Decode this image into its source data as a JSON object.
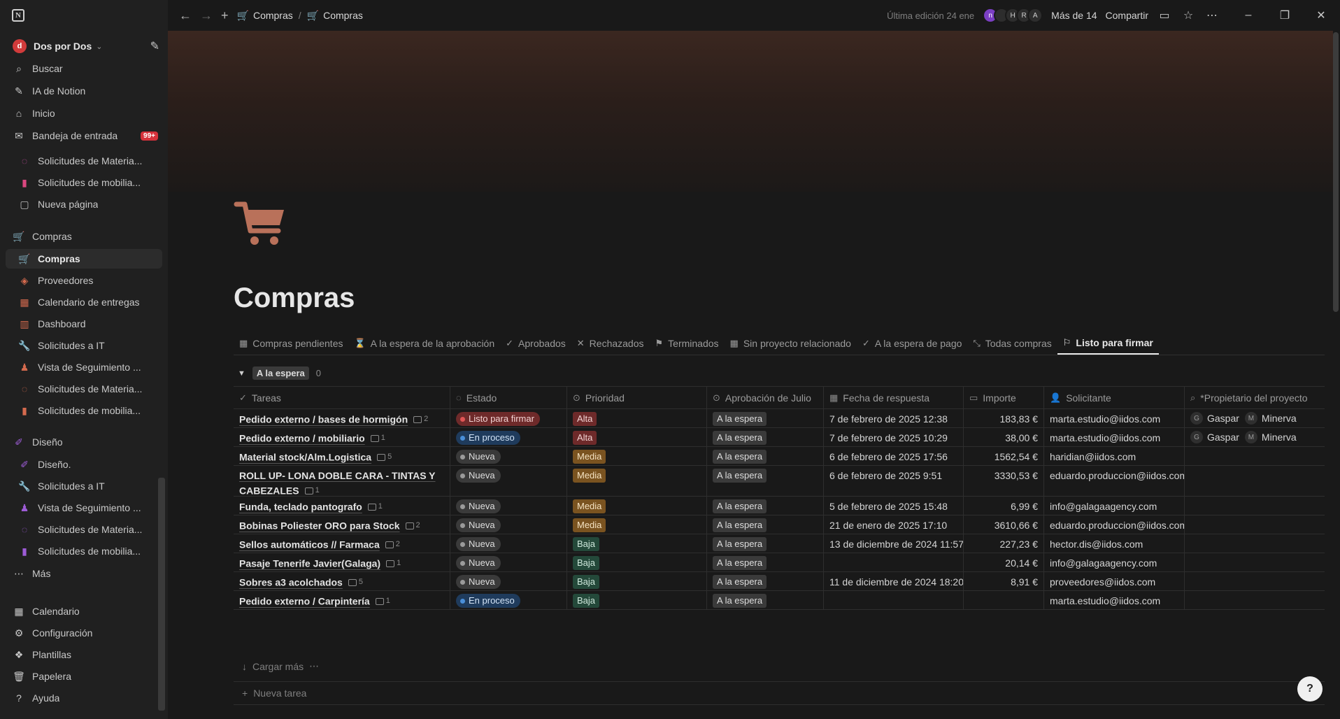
{
  "sidebar": {
    "workspace": {
      "initial": "d",
      "name": "Dos por Dos"
    },
    "top_items": [
      {
        "icon": "search-icon",
        "glyph": "⌕",
        "label": "Buscar"
      },
      {
        "icon": "ai-icon",
        "glyph": "✎",
        "label": "IA de Notion"
      },
      {
        "icon": "home-icon",
        "glyph": "⌂",
        "label": "Inicio"
      },
      {
        "icon": "inbox-icon",
        "glyph": "✉",
        "label": "Bandeja de entrada",
        "badge": "99+"
      }
    ],
    "recent_items": [
      {
        "icon": "dashed-circle-icon",
        "glyph": "◌",
        "color": "#c94fa3",
        "label": "Solicitudes de Materia..."
      },
      {
        "icon": "chart-icon",
        "glyph": "▮",
        "color": "#d9477f",
        "label": "Solicitudes de mobilia..."
      },
      {
        "icon": "page-icon",
        "glyph": "▢",
        "color": "#bdbdbd",
        "label": "Nueva página"
      }
    ],
    "compras_section": {
      "label": "Compras",
      "items": [
        {
          "icon": "cart-icon",
          "glyph": "🛒",
          "color": "#c77a5e",
          "label": "Compras",
          "active": true
        },
        {
          "icon": "box-icon",
          "glyph": "◈",
          "color": "#d46a4e",
          "label": "Proveedores"
        },
        {
          "icon": "calendar-icon",
          "glyph": "▦",
          "color": "#d46a4e",
          "label": "Calendario de entregas"
        },
        {
          "icon": "dashboard-icon",
          "glyph": "▥",
          "color": "#d46a4e",
          "label": "Dashboard"
        },
        {
          "icon": "wrench-icon",
          "glyph": "🔧",
          "color": "#d46a4e",
          "label": "Solicitudes a IT"
        },
        {
          "icon": "people-icon",
          "glyph": "♟",
          "color": "#d46a4e",
          "label": "Vista de Seguimiento ..."
        },
        {
          "icon": "dashed-circle-icon",
          "glyph": "◌",
          "color": "#d46a4e",
          "label": "Solicitudes de Materia..."
        },
        {
          "icon": "chart-icon",
          "glyph": "▮",
          "color": "#d46a4e",
          "label": "Solicitudes de mobilia..."
        }
      ]
    },
    "diseno_section": {
      "label": "Diseño",
      "items": [
        {
          "icon": "pen-icon",
          "glyph": "✐",
          "color": "#9d5cd6",
          "label": "Diseño."
        },
        {
          "icon": "wrench-icon",
          "glyph": "🔧",
          "color": "#9d5cd6",
          "label": "Solicitudes a IT"
        },
        {
          "icon": "people-icon",
          "glyph": "♟",
          "color": "#9d5cd6",
          "label": "Vista de Seguimiento ..."
        },
        {
          "icon": "dashed-circle-icon",
          "glyph": "◌",
          "color": "#9d5cd6",
          "label": "Solicitudes de Materia..."
        },
        {
          "icon": "chart-icon",
          "glyph": "▮",
          "color": "#9d5cd6",
          "label": "Solicitudes de mobilia..."
        }
      ]
    },
    "more_label": "Más",
    "bottom_items": [
      {
        "icon": "calendar-icon",
        "glyph": "▦",
        "label": "Calendario"
      },
      {
        "icon": "gear-icon",
        "glyph": "⚙",
        "label": "Configuración"
      },
      {
        "icon": "templates-icon",
        "glyph": "❖",
        "label": "Plantillas"
      },
      {
        "icon": "trash-icon",
        "glyph": "🗑",
        "label": "Papelera"
      },
      {
        "icon": "help-icon",
        "glyph": "?",
        "label": "Ayuda"
      }
    ]
  },
  "topbar": {
    "breadcrumb": [
      "Compras",
      "Compras"
    ],
    "last_edit": "Última edición 24 ene",
    "avatars": [
      "n",
      "",
      "H",
      "R",
      "A"
    ],
    "more_people": "Más de 14",
    "share": "Compartir"
  },
  "page": {
    "title": "Compras",
    "views": [
      {
        "icon": "table-icon",
        "glyph": "▦",
        "label": "Compras pendientes"
      },
      {
        "icon": "hourglass-icon",
        "glyph": "⌛",
        "label": "A la espera de la aprobación"
      },
      {
        "icon": "check-icon",
        "glyph": "✓",
        "label": "Aprobados"
      },
      {
        "icon": "x-icon",
        "glyph": "✕",
        "label": "Rechazados"
      },
      {
        "icon": "flag-checkered-icon",
        "glyph": "⚑",
        "label": "Terminados"
      },
      {
        "icon": "table-icon",
        "glyph": "▦",
        "label": "Sin proyecto relacionado"
      },
      {
        "icon": "check-icon",
        "glyph": "✓",
        "label": "A la espera de pago"
      },
      {
        "icon": "collapse-icon",
        "glyph": "⤡",
        "label": "Todas compras"
      },
      {
        "icon": "flag-icon",
        "glyph": "⚐",
        "label": "Listo para firmar",
        "active": true
      }
    ],
    "group": {
      "label": "A la espera",
      "count": "0"
    },
    "columns": [
      {
        "icon": "check-icon",
        "glyph": "✓",
        "label": "Tareas"
      },
      {
        "icon": "status-icon",
        "glyph": "◌",
        "label": "Estado"
      },
      {
        "icon": "select-icon",
        "glyph": "⊙",
        "label": "Prioridad"
      },
      {
        "icon": "select-icon",
        "glyph": "⊙",
        "label": "Aprobación de Julio"
      },
      {
        "icon": "calendar-icon",
        "glyph": "▦",
        "label": "Fecha de respuesta"
      },
      {
        "icon": "money-icon",
        "glyph": "▭",
        "label": "Importe"
      },
      {
        "icon": "person-icon",
        "glyph": "👤",
        "label": "Solicitante"
      },
      {
        "icon": "search-icon",
        "glyph": "⌕",
        "label": "*Propietario del proyecto"
      }
    ],
    "rows": [
      {
        "task": "Pedido externo / bases de hormigón",
        "comments": "2",
        "estado": "Listo para firmar",
        "prioridad": "Alta",
        "aprobacion": "A la espera",
        "fecha": "7 de febrero de 2025 12:38",
        "importe": "183,83 €",
        "solicitante": "marta.estudio@iidos.com",
        "propietarios": [
          {
            "initial": "G",
            "name": "Gaspar"
          },
          {
            "initial": "M",
            "name": "Minerva"
          }
        ]
      },
      {
        "task": "Pedido externo / mobiliario",
        "comments": "1",
        "estado": "En proceso",
        "prioridad": "Alta",
        "aprobacion": "A la espera",
        "fecha": "7 de febrero de 2025 10:29",
        "importe": "38,00 €",
        "solicitante": "marta.estudio@iidos.com",
        "propietarios": [
          {
            "initial": "G",
            "name": "Gaspar"
          },
          {
            "initial": "M",
            "name": "Minerva"
          }
        ]
      },
      {
        "task": "Material stock/Alm.Logistica",
        "comments": "5",
        "estado": "Nueva",
        "prioridad": "Media",
        "aprobacion": "A la espera",
        "fecha": "6 de febrero de 2025 17:56",
        "importe": "1562,54 €",
        "solicitante": "haridian@iidos.com",
        "propietarios": []
      },
      {
        "task": "ROLL UP- LONA DOBLE CARA - TINTAS Y CABEZALES",
        "comments": "1",
        "estado": "Nueva",
        "prioridad": "Media",
        "aprobacion": "A la espera",
        "fecha": "6 de febrero de 2025 9:51",
        "importe": "3330,53 €",
        "solicitante": "eduardo.produccion@iidos.com",
        "propietarios": [],
        "tall": true
      },
      {
        "task": "Funda, teclado pantografo",
        "comments": "1",
        "estado": "Nueva",
        "prioridad": "Media",
        "aprobacion": "A la espera",
        "fecha": "5 de febrero de 2025 15:48",
        "importe": "6,99 €",
        "solicitante": "info@galagaagency.com",
        "propietarios": []
      },
      {
        "task": "Bobinas Poliester ORO para Stock",
        "comments": "2",
        "estado": "Nueva",
        "prioridad": "Media",
        "aprobacion": "A la espera",
        "fecha": "21 de enero de 2025 17:10",
        "importe": "3610,66 €",
        "solicitante": "eduardo.produccion@iidos.com",
        "propietarios": []
      },
      {
        "task": "Sellos automáticos // Farmaca",
        "comments": "2",
        "estado": "Nueva",
        "prioridad": "Baja",
        "aprobacion": "A la espera",
        "fecha": "13 de diciembre de 2024 11:57",
        "importe": "227,23 €",
        "solicitante": "hector.dis@iidos.com",
        "propietarios": []
      },
      {
        "task": "Pasaje Tenerife Javier(Galaga)",
        "comments": "1",
        "estado": "Nueva",
        "prioridad": "Baja",
        "aprobacion": "A la espera",
        "fecha": "",
        "importe": "20,14 €",
        "solicitante": "info@galagaagency.com",
        "propietarios": []
      },
      {
        "task": "Sobres a3 acolchados",
        "comments": "5",
        "estado": "Nueva",
        "prioridad": "Baja",
        "aprobacion": "A la espera",
        "fecha": "11 de diciembre de 2024 18:20",
        "importe": "8,91 €",
        "solicitante": "proveedores@iidos.com",
        "propietarios": []
      },
      {
        "task": "Pedido externo / Carpintería",
        "comments": "1",
        "estado": "En proceso",
        "prioridad": "Baja",
        "aprobacion": "A la espera",
        "fecha": "",
        "importe": "",
        "solicitante": "marta.estudio@iidos.com",
        "propietarios": []
      }
    ],
    "load_more": "Cargar más",
    "new_task": "Nueva tarea"
  },
  "colors": {
    "estado": {
      "Listo para firmar": {
        "bg": "#6e2a2a",
        "dot": "#e05555",
        "fg": "#f2d4d4"
      },
      "En proceso": {
        "bg": "#1f3b5c",
        "dot": "#4a8fd9",
        "fg": "#d3e4f7"
      },
      "Nueva": {
        "bg": "#3a3a3a",
        "dot": "#9b9b9b",
        "fg": "#dedede"
      }
    },
    "prioridad": {
      "Alta": {
        "bg": "#6e2a2a",
        "fg": "#f2d4d4"
      },
      "Media": {
        "bg": "#7a5320",
        "fg": "#f4e2c2"
      },
      "Baja": {
        "bg": "#24493a",
        "fg": "#cfe8dc"
      }
    },
    "aprobacion": {
      "bg": "#3a3a3a",
      "fg": "#dedede"
    }
  }
}
